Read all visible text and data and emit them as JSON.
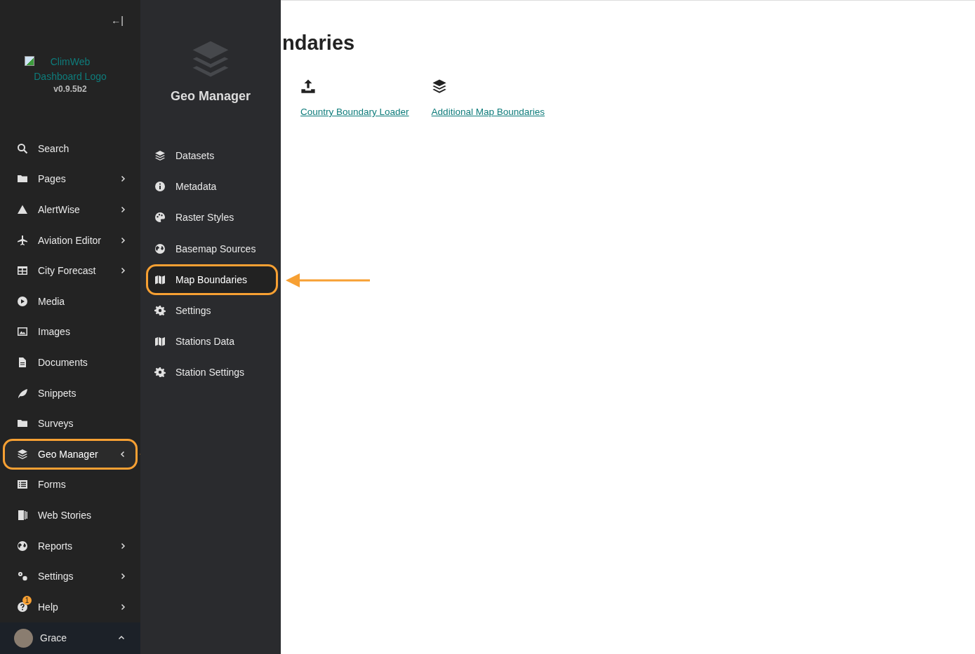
{
  "sidebar": {
    "collapse_button": "←|",
    "logo_alt": "ClimWeb Dashboard Logo",
    "version": "v0.9.5b2",
    "items": [
      {
        "label": "Search",
        "has_submenu": false,
        "selected": false,
        "highlighted": false
      },
      {
        "label": "Pages",
        "has_submenu": true,
        "expanded": false,
        "selected": false,
        "highlighted": false
      },
      {
        "label": "AlertWise",
        "has_submenu": true,
        "expanded": false,
        "selected": false,
        "highlighted": false
      },
      {
        "label": "Aviation Editor",
        "has_submenu": true,
        "expanded": false,
        "selected": false,
        "highlighted": false
      },
      {
        "label": "City Forecast",
        "has_submenu": true,
        "expanded": false,
        "selected": false,
        "highlighted": false
      },
      {
        "label": "Media",
        "has_submenu": false,
        "selected": false,
        "highlighted": false
      },
      {
        "label": "Images",
        "has_submenu": false,
        "selected": false,
        "highlighted": false
      },
      {
        "label": "Documents",
        "has_submenu": false,
        "selected": false,
        "highlighted": false
      },
      {
        "label": "Snippets",
        "has_submenu": false,
        "selected": false,
        "highlighted": false
      },
      {
        "label": "Surveys",
        "has_submenu": false,
        "selected": false,
        "highlighted": false
      },
      {
        "label": "Geo Manager",
        "has_submenu": true,
        "expanded": true,
        "selected": true,
        "highlighted": true
      },
      {
        "label": "Forms",
        "has_submenu": false,
        "selected": false,
        "highlighted": false
      },
      {
        "label": "Web Stories",
        "has_submenu": false,
        "selected": false,
        "highlighted": false
      },
      {
        "label": "Reports",
        "has_submenu": true,
        "expanded": false,
        "selected": false,
        "highlighted": false
      },
      {
        "label": "Settings",
        "has_submenu": true,
        "expanded": false,
        "selected": false,
        "highlighted": false
      },
      {
        "label": "Help",
        "has_submenu": true,
        "expanded": false,
        "selected": false,
        "highlighted": false,
        "badge": "1"
      }
    ],
    "user": {
      "name": "Grace",
      "expanded": false
    }
  },
  "submenu": {
    "title": "Geo Manager",
    "items": [
      {
        "label": "Datasets",
        "selected": false,
        "highlighted": false
      },
      {
        "label": "Metadata",
        "selected": false,
        "highlighted": false
      },
      {
        "label": "Raster Styles",
        "selected": false,
        "highlighted": false
      },
      {
        "label": "Basemap Sources",
        "selected": false,
        "highlighted": false
      },
      {
        "label": "Map Boundaries",
        "selected": true,
        "highlighted": true
      },
      {
        "label": "Settings",
        "selected": false,
        "highlighted": false
      },
      {
        "label": "Stations Data",
        "selected": false,
        "highlighted": false
      },
      {
        "label": "Station Settings",
        "selected": false,
        "highlighted": false
      }
    ]
  },
  "main": {
    "heading": "ndaries",
    "links": [
      {
        "label": "Country Boundary Loader"
      },
      {
        "label": "Additional Map Boundaries"
      }
    ]
  }
}
